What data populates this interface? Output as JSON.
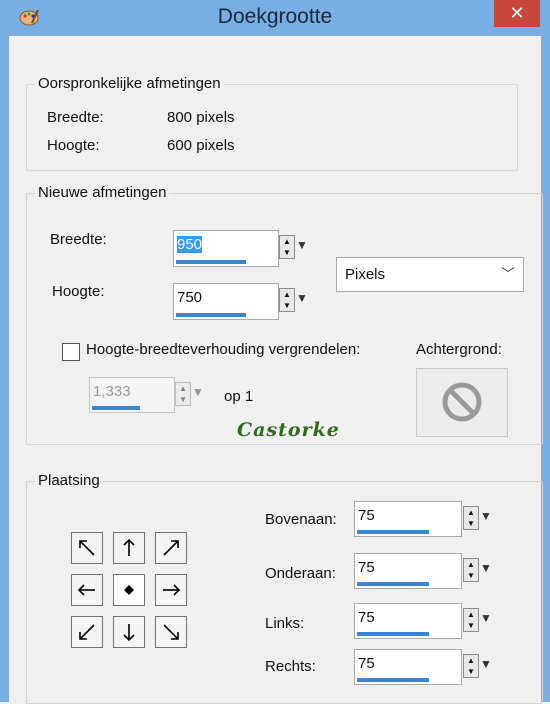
{
  "window": {
    "title": "Doekgrootte",
    "close_symbol": "✕"
  },
  "original": {
    "group_title": "Oorspronkelijke afmetingen",
    "width_label": "Breedte:",
    "width_value": "800 pixels",
    "height_label": "Hoogte:",
    "height_value": "600 pixels"
  },
  "new": {
    "group_title": "Nieuwe afmetingen",
    "width_label": "Breedte:",
    "width_value": "950",
    "height_label": "Hoogte:",
    "height_value": "750",
    "unit_selected": "Pixels",
    "lock_label": "Hoogte-breedteverhouding vergrendelen:",
    "lock_checked": false,
    "ratio_value": "1,333",
    "ratio_suffix": "op 1",
    "background_label": "Achtergrond:",
    "watermark": "Castorke"
  },
  "placement": {
    "group_title": "Plaatsing",
    "top_label": "Bovenaan:",
    "top_value": "75",
    "bottom_label": "Onderaan:",
    "bottom_value": "75",
    "left_label": "Links:",
    "left_value": "75",
    "right_label": "Rechts:",
    "right_value": "75"
  },
  "colors": {
    "title_bar": "#78aee3",
    "close_button": "#c7473b",
    "highlight": "#3399ff",
    "progress": "#3a86d6",
    "watermark": "#2e6b1d"
  }
}
